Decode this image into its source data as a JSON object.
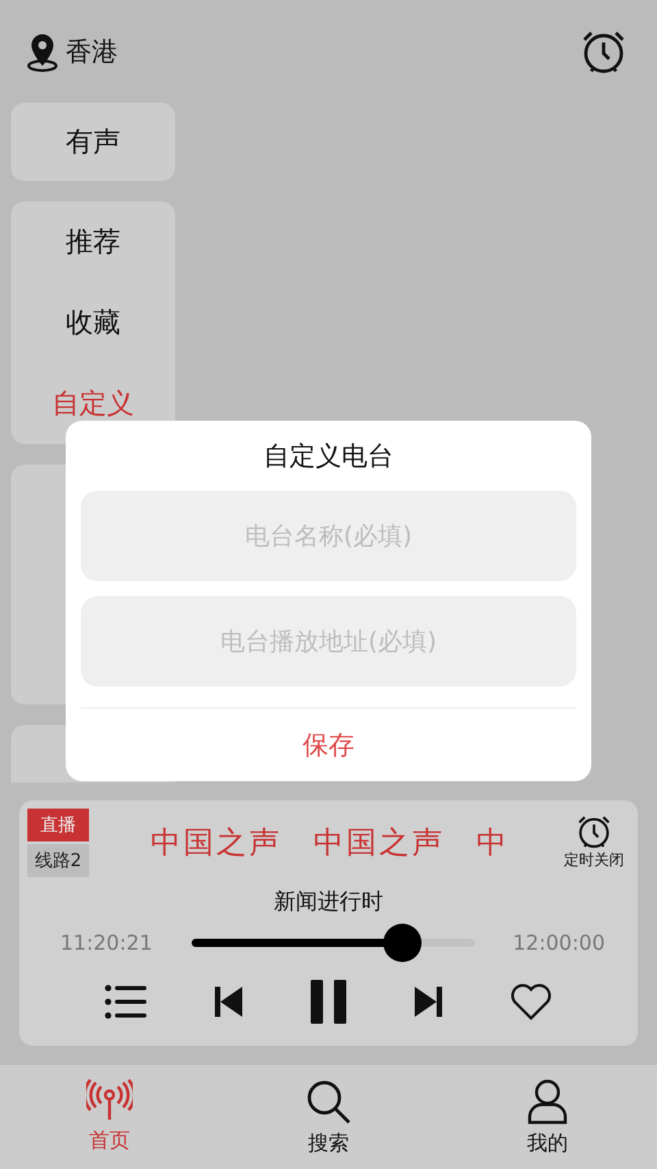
{
  "header": {
    "location": "香港"
  },
  "sidebar": {
    "groups": [
      {
        "items": [
          {
            "label": "有声",
            "selected": false
          }
        ]
      },
      {
        "items": [
          {
            "label": "推荐",
            "selected": false
          },
          {
            "label": "收藏",
            "selected": false
          },
          {
            "label": "自定义",
            "selected": true
          }
        ]
      }
    ]
  },
  "dialog": {
    "title": "自定义电台",
    "fields": [
      {
        "placeholder": "电台名称(必填)"
      },
      {
        "placeholder": "电台播放地址(必填)"
      }
    ],
    "save_button": "保存"
  },
  "player": {
    "live_badge": "直播",
    "line_badge": "线路2",
    "station_marquee": [
      "中国之声",
      "中国之声",
      "中"
    ],
    "sleep_timer": "定时关闭",
    "program": "新闻进行时",
    "elapsed": "11:20:21",
    "total": "12:00:00",
    "progress": {
      "level": 0.73
    },
    "paused": false
  },
  "tabs": [
    {
      "label": "首页",
      "selected": true
    },
    {
      "label": "搜索",
      "selected": false
    },
    {
      "label": "我的",
      "selected": false
    }
  ]
}
